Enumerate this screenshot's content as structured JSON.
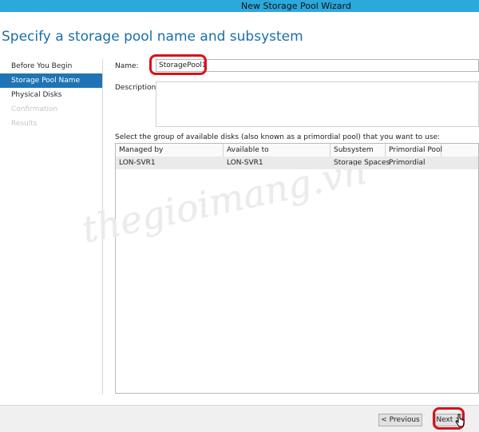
{
  "window": {
    "title": "New Storage Pool Wizard"
  },
  "heading": "Specify a storage pool name and subsystem",
  "nav": {
    "items": [
      {
        "label": "Before You Begin",
        "state": "normal"
      },
      {
        "label": "Storage Pool Name",
        "state": "active"
      },
      {
        "label": "Physical Disks",
        "state": "normal"
      },
      {
        "label": "Confirmation",
        "state": "disabled"
      },
      {
        "label": "Results",
        "state": "disabled"
      }
    ]
  },
  "form": {
    "name_label": "Name:",
    "name_value": "StoragePool1",
    "description_label": "Description:",
    "description_value": ""
  },
  "disks": {
    "instruction": "Select the group of available disks (also known as a primordial pool) that you want to use:",
    "columns": [
      "Managed by",
      "Available to",
      "Subsystem",
      "Primordial Pool"
    ],
    "rows": [
      [
        "LON-SVR1",
        "LON-SVR1",
        "Storage Spaces",
        "Primordial"
      ]
    ]
  },
  "watermark": "thegioimang.vn",
  "buttons": {
    "previous": "< Previous",
    "next": "Next >"
  },
  "colors": {
    "titlebar": "#2ba8dc",
    "nav_active": "#1f74b5",
    "heading": "#1a6fa8",
    "highlight": "#d9121b"
  }
}
